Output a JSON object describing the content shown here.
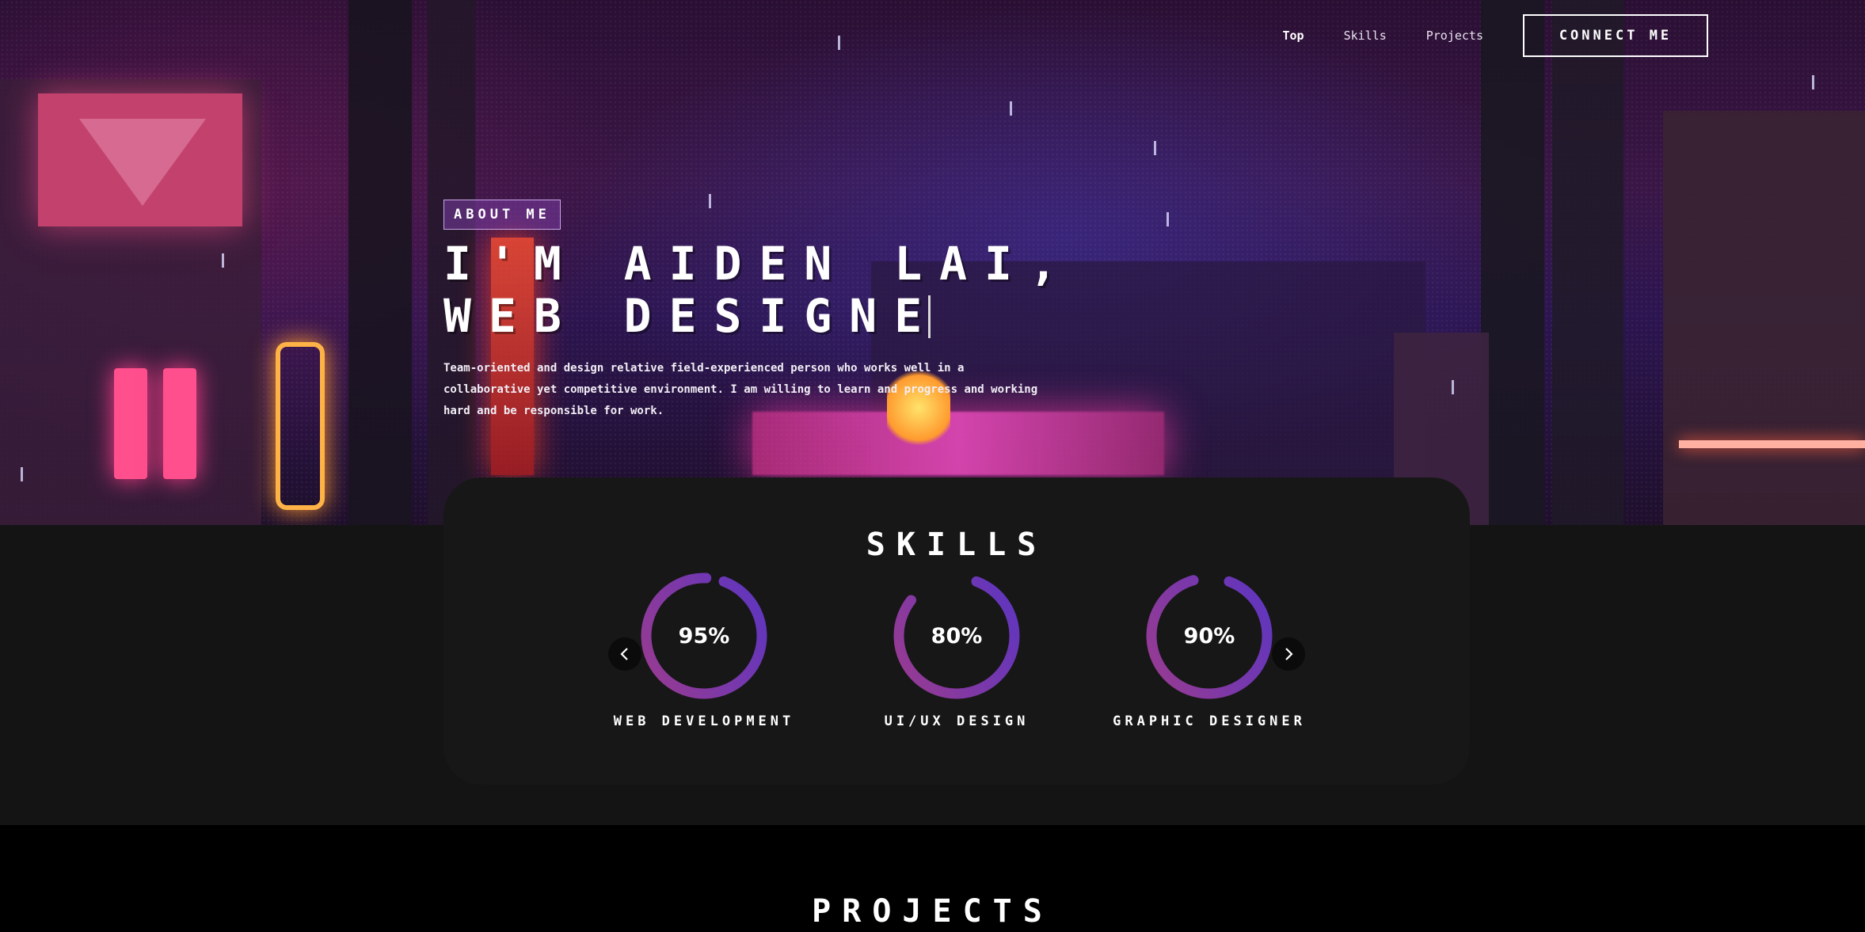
{
  "nav": {
    "links": [
      "Top",
      "Skills",
      "Projects"
    ],
    "connect_label": "CONNECT ME"
  },
  "about": {
    "tag": "ABOUT ME",
    "title_line1": "I'M AIDEN LAI,",
    "title_line2": "WEB DESIGNE",
    "description": "Team-oriented and design relative field-experienced person who works well in a collaborative yet competitive environment. I am willing to learn and progress and working hard and be responsible for work."
  },
  "skills": {
    "title": "SKILLS",
    "items": [
      {
        "name": "WEB DEVELOPMENT",
        "percent_label": "95%",
        "value": 95
      },
      {
        "name": "UI/UX DESIGN",
        "percent_label": "80%",
        "value": 80
      },
      {
        "name": "GRAPHIC DESIGNER",
        "percent_label": "90%",
        "value": 90
      }
    ]
  },
  "projects": {
    "title": "PROJECTS"
  },
  "colors": {
    "ring_start": "#9b3b8f",
    "ring_end": "#5b35c2",
    "card_bg": "#171717",
    "accent_pink": "#ff3f8e"
  },
  "icons": {
    "prev": "chevron-left-icon",
    "next": "chevron-right-icon"
  }
}
